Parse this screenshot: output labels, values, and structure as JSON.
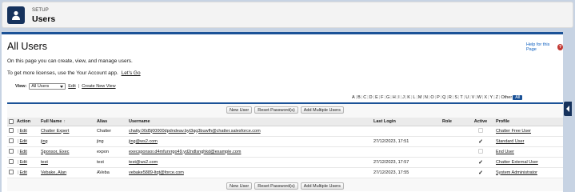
{
  "header": {
    "eyebrow": "SETUP",
    "title": "Users"
  },
  "page": {
    "title": "All Users",
    "help_link": "Help for this Page",
    "help_icon": "?",
    "intro": "On this page you can create, view, and manage users.",
    "licenses_text": "To get more licenses, use the Your Account app.",
    "licenses_link": "Let's Go"
  },
  "view": {
    "label": "View:",
    "selected": "All Users",
    "edit_link": "Edit",
    "separator": "|",
    "create_link": "Create New View"
  },
  "alphabet": [
    "A",
    "B",
    "C",
    "D",
    "E",
    "F",
    "G",
    "H",
    "I",
    "J",
    "K",
    "L",
    "M",
    "N",
    "O",
    "P",
    "Q",
    "R",
    "S",
    "T",
    "U",
    "V",
    "W",
    "X",
    "Y",
    "Z",
    "Other",
    "All"
  ],
  "buttons": {
    "new_user": "New User",
    "reset_passwords": "Reset Password(s)",
    "add_multiple": "Add Multiple Users"
  },
  "table": {
    "columns": {
      "action": "Action",
      "full_name": "Full Name",
      "sort_indicator": "↑",
      "alias": "Alias",
      "username": "Username",
      "last_login": "Last Login",
      "role": "Role",
      "active": "Active",
      "profile": "Profile"
    },
    "action_label": "Edit",
    "action_separator": "|",
    "rows": [
      {
        "full_name": "Chatter Expert",
        "alias": "Chatter",
        "username": "chatty.00d5j00000dpdndeav.byt3qq3buwfh@chatter.salesforce.com",
        "last_login": "",
        "role": "",
        "active": false,
        "profile": "Chatter Free User"
      },
      {
        "full_name": "jing",
        "alias": "jing",
        "username": "jing@ws2.com",
        "last_login": "27/12/2023, 17:51",
        "role": "",
        "active": true,
        "profile": "Standard User"
      },
      {
        "full_name": "Sponsor, Exec",
        "alias": "expon",
        "username": "execsponsor.d4mfunrrgo49.yd2ndlsnghkd@example.com",
        "last_login": "",
        "role": "",
        "active": false,
        "profile": "End User"
      },
      {
        "full_name": "test",
        "alias": "test",
        "username": "test@ws2.com",
        "last_login": "27/12/2023, 17:57",
        "role": "",
        "active": true,
        "profile": "Chatter External User"
      },
      {
        "full_name": "Vebake, Alan",
        "alias": "AVeba",
        "username": "vebake5889-ltqt@force.com",
        "last_login": "27/12/2023, 17:55",
        "role": "",
        "active": true,
        "profile": "System Administrator"
      }
    ],
    "check_glyph": "✓"
  }
}
